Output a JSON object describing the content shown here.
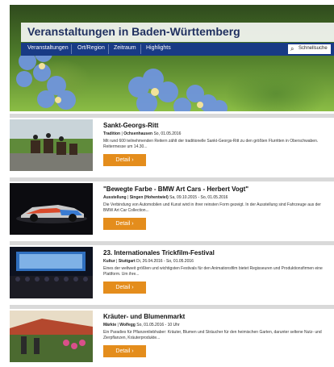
{
  "header": {
    "title": "Veranstaltungen in Baden-Württemberg",
    "nav": [
      "Veranstaltungen",
      "Ort/Region",
      "Zeitraum",
      "Highlights"
    ],
    "search_label": "Schnellsuche",
    "search_icon": "search-icon"
  },
  "events": [
    {
      "title": "Sankt-Georgs-Ritt",
      "category": "Tradition",
      "place": "Ochsenhausen",
      "date": "So, 01.05.2016",
      "description": "Mit rund 600 teilnehmenden Reitern zählt der traditionelle Sankt-Georgs-Ritt zu den größten Flurritten in Oberschwaben. Reitermesse um 14.30...",
      "button": "Detail ›"
    },
    {
      "title": "\"Bewegte Farbe - BMW Art Cars - Herbert Vogt\"",
      "category": "Ausstellung",
      "place": "Singen (Hohentwiel)",
      "date": "Sa, 09.10.2015 - So, 01.05.2016",
      "description": "Die Verbindung von Automobilen und Kunst wird in ihrer reinsten Form gezeigt. In der Ausstellung sind Fahrzeuge aus der BMW Art Car Collection...",
      "button": "Detail ›"
    },
    {
      "title": "23. Internationales Trickfilm-Festival",
      "category": "Kultur",
      "place": "Stuttgart",
      "date": "Di, 26.04.2016 - So, 01.05.2016",
      "description": "Eines der weltweit größten und wichtigsten Festivals für den Animationsfilm bietet Regisseuren und Produktionsfirmen eine Plattform. Um ihre...",
      "button": "Detail ›"
    },
    {
      "title": "Kräuter- und Blumenmarkt",
      "category": "Märkte",
      "place": "Wolfegg",
      "date": "So, 01.05.2016 - 10 Uhr",
      "description": "Ein Paradies für Pflanzenliebhaber: Kräuter, Blumen und Sträucher für den heimischen Garten, darunter seltene Nutz- und Zierpflanzen, Kräuterprodukte...",
      "button": "Detail ›"
    }
  ]
}
